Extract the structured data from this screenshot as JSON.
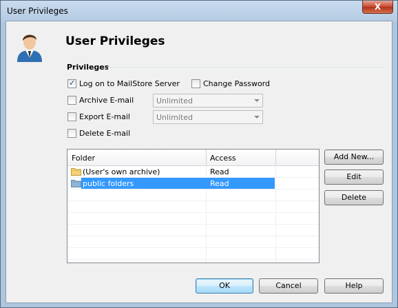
{
  "window": {
    "title": "User Privileges",
    "close_glyph": "X"
  },
  "header": {
    "title": "User Privileges",
    "avatar_icon": "user-avatar-icon"
  },
  "privileges": {
    "group_label": "Privileges",
    "items": {
      "logon": {
        "label": "Log on to MailStore Server",
        "checked": true
      },
      "change_password": {
        "label": "Change Password",
        "checked": false
      },
      "archive": {
        "label": "Archive E-mail",
        "checked": false,
        "combo_value": "Unlimited"
      },
      "export": {
        "label": "Export E-mail",
        "checked": false,
        "combo_value": "Unlimited"
      },
      "delete": {
        "label": "Delete E-mail",
        "checked": false
      }
    }
  },
  "folders": {
    "columns": [
      "Folder",
      "Access"
    ],
    "rows": [
      {
        "folder": "(User's own archive)",
        "access": "Read",
        "icon": "folder-icon",
        "selected": false
      },
      {
        "folder": "public folders",
        "access": "Read",
        "icon": "folder-icon",
        "selected": true
      }
    ]
  },
  "side_buttons": {
    "add_new": "Add New...",
    "edit": "Edit",
    "delete": "Delete"
  },
  "footer": {
    "ok": "OK",
    "cancel": "Cancel",
    "help": "Help"
  },
  "colors": {
    "selection": "#3399ff",
    "client_bg": "#f0f0f0"
  }
}
